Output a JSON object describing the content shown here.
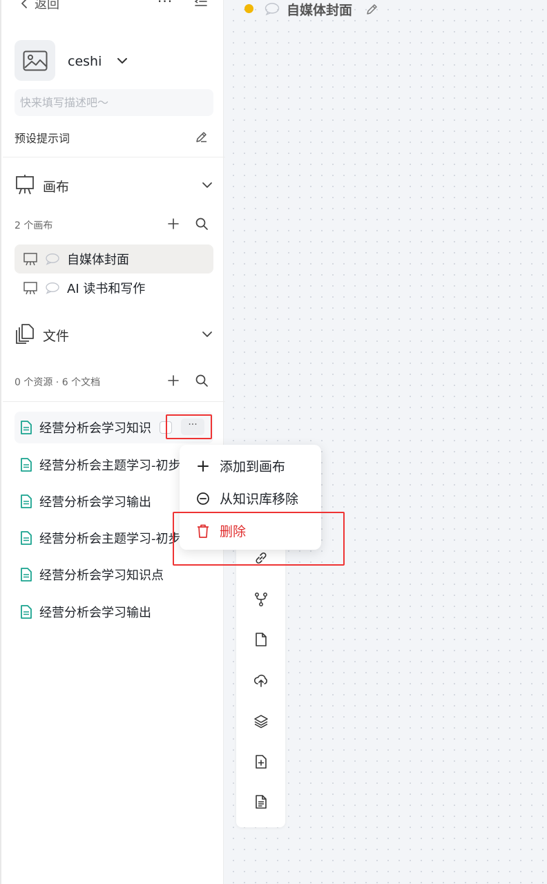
{
  "header": {
    "back_label": "返回",
    "canvas_title": "自媒体封面"
  },
  "workspace": {
    "name": "ceshi",
    "description_placeholder": "快来填写描述吧～",
    "preset_prompt_label": "预设提示词"
  },
  "canvas_section": {
    "title": "画布",
    "count_label": "2 个画布",
    "items": [
      {
        "label": "自媒体封面",
        "active": true
      },
      {
        "label": "AI 读书和写作",
        "active": false
      }
    ]
  },
  "files_section": {
    "title": "文件",
    "count_label": "0 个资源 · 6 个文档",
    "items": [
      {
        "label": "经营分析会学习知识"
      },
      {
        "label": "经营分析会主题学习-初步"
      },
      {
        "label": "经营分析会学习输出"
      },
      {
        "label": "经营分析会主题学习-初步"
      },
      {
        "label": "经营分析会学习知识点"
      },
      {
        "label": "经营分析会学习输出"
      }
    ],
    "more_label": "···"
  },
  "context_menu": {
    "items": [
      {
        "label": "添加到画布",
        "icon": "plus-icon"
      },
      {
        "label": "从知识库移除",
        "icon": "minus-circle-icon"
      },
      {
        "label": "删除",
        "icon": "trash-icon",
        "danger": true
      }
    ]
  },
  "toolbar": {
    "icons": [
      "link-icon",
      "branch-icon",
      "blank-doc-icon",
      "cloud-upload-icon",
      "layers-icon",
      "new-doc-icon",
      "text-doc-icon"
    ]
  },
  "colors": {
    "accent_dot": "#f2b705",
    "file_icon": "#19a38f",
    "danger": "#e02e2e",
    "highlight_border": "#e33"
  }
}
